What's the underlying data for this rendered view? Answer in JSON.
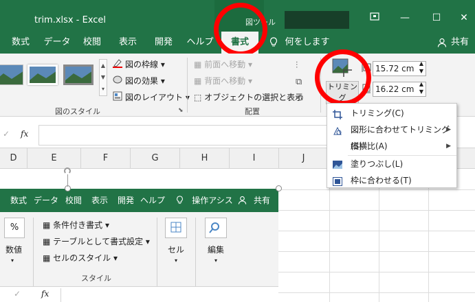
{
  "titlebar": {
    "filename": "trim.xlsx",
    "separator": "-",
    "app": "Excel",
    "context_label": "図ツール",
    "restore_icon": "restore-icon",
    "minimize": "—",
    "maximize": "☐",
    "close": "✕"
  },
  "tabs": [
    {
      "label": "数式"
    },
    {
      "label": "データ"
    },
    {
      "label": "校閲"
    },
    {
      "label": "表示"
    },
    {
      "label": "開発"
    },
    {
      "label": "ヘルプ"
    },
    {
      "label": "書式"
    },
    {
      "label": "何をしますか"
    },
    {
      "label": "共有"
    }
  ],
  "ribbon": {
    "picture_styles_label": "図のスタイル",
    "picture_border": "図の枠線",
    "picture_effects": "図の効果",
    "picture_layout": "図のレイアウト",
    "bring_forward": "前面へ移動",
    "send_backward": "背面へ移動",
    "selection_pane": "オブジェクトの選択と表示",
    "arrange_label": "配置",
    "crop_label": "トリミング",
    "height_value": "15.72 cm",
    "width_value": "16.22 cm"
  },
  "formula_bar": {
    "fx": "fx"
  },
  "columns": [
    "D",
    "E",
    "F",
    "G",
    "H",
    "I",
    "J"
  ],
  "dropdown": {
    "items": [
      {
        "label": "トリミング(C)",
        "icon": "crop-icon"
      },
      {
        "label": "図形に合わせてトリミング(S)",
        "icon": "shape-crop-icon"
      },
      {
        "label": "縦横比(A)",
        "icon": ""
      },
      {
        "label": "塗りつぶし(L)",
        "icon": "fill-icon"
      },
      {
        "label": "枠に合わせる(T)",
        "icon": "fit-icon"
      }
    ]
  },
  "embedded": {
    "tabs": [
      {
        "label": "数式"
      },
      {
        "label": "データ"
      },
      {
        "label": "校閲"
      },
      {
        "label": "表示"
      },
      {
        "label": "開発"
      },
      {
        "label": "ヘルプ"
      },
      {
        "label": "操作アシス"
      },
      {
        "label": "共有"
      }
    ],
    "number_label": "数値",
    "percent": "%",
    "conditional_format": "条件付き書式",
    "format_as_table": "テーブルとして書式設定",
    "cell_styles": "セルのスタイル",
    "styles_label": "スタイル",
    "cells_label": "セル",
    "editing_label": "編集",
    "fx": "fx"
  },
  "colors": {
    "excel_green": "#217346",
    "highlight_red": "#ff0000",
    "ribbon_bg": "#f3f3f3"
  }
}
